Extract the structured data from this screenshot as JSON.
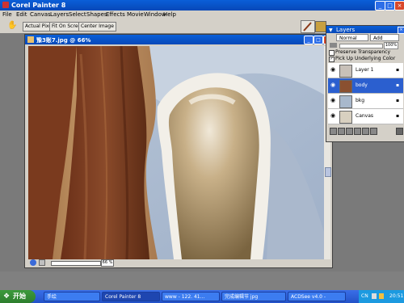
{
  "app": {
    "title": "Corel Painter 8"
  },
  "menu": [
    "File",
    "Edit",
    "Canvas",
    "Layers",
    "Select",
    "Shapes",
    "Effects",
    "Movie",
    "Window",
    "Help"
  ],
  "property_bar": {
    "buttons": [
      "Actual Pixels",
      "Fit On Screen",
      "Center Image"
    ]
  },
  "document": {
    "title": "豫3账7.jpg @ 66%",
    "zoom": "66 %"
  },
  "layers_panel": {
    "title": "Layers",
    "composite_method": "Normal",
    "add_button": "Add",
    "opacity": "100%",
    "options": [
      {
        "label": "Preserve Transparency",
        "checked": false
      },
      {
        "label": "Pick Up Underlying Color",
        "checked": true
      }
    ],
    "layers": [
      {
        "name": "Layer 1",
        "selected": false
      },
      {
        "name": "body",
        "selected": true
      },
      {
        "name": "bkg",
        "selected": false
      },
      {
        "name": "Canvas",
        "selected": false
      }
    ]
  },
  "taskbar": {
    "start_label": "开始",
    "tasks": [
      {
        "label": "手绘",
        "active": false
      },
      {
        "label": "Corel Painter 8",
        "active": true
      },
      {
        "label": "www - 122. 41...",
        "active": false
      },
      {
        "label": "完成编辑节 jpg",
        "active": false
      },
      {
        "label": "ACDSee v4.0 -",
        "active": false
      }
    ],
    "tray_lang": "CN",
    "clock": "20:51"
  },
  "colors": {
    "title_blue": "#0a5fd8",
    "selected_layer": "#2b5fcf",
    "taskbar": "#2352c8",
    "start_green": "#3c9a3c"
  }
}
